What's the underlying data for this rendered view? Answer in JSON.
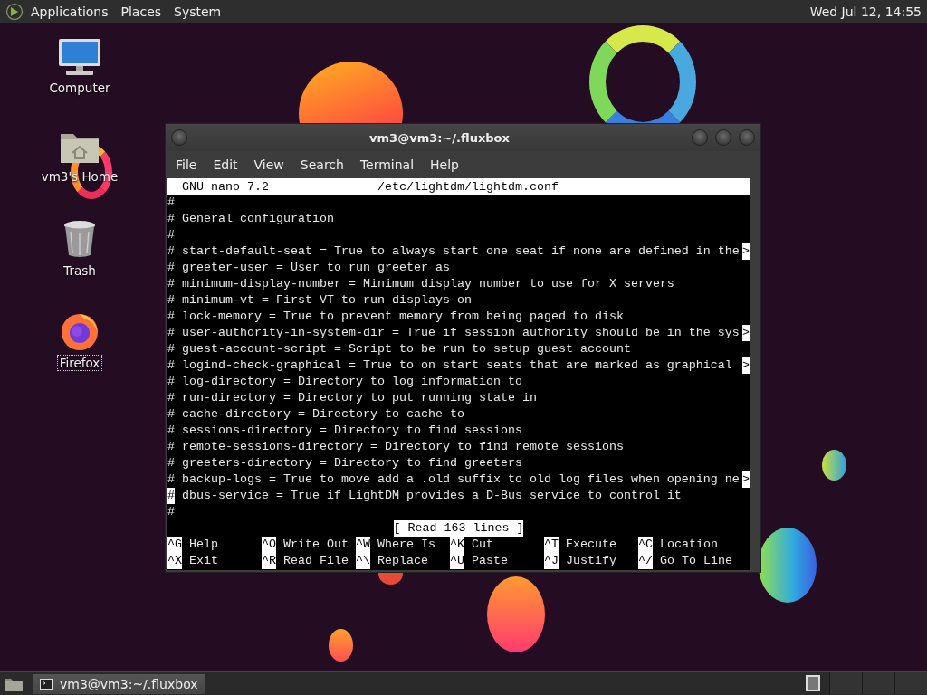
{
  "top_panel": {
    "menus": [
      {
        "label": "Applications"
      },
      {
        "label": "Places"
      },
      {
        "label": "System"
      }
    ],
    "clock": "Wed Jul 12, 14:55"
  },
  "desktop_icons": [
    {
      "label": "Computer",
      "kind": "computer",
      "selected": false
    },
    {
      "label": "vm3's Home",
      "kind": "home",
      "selected": false
    },
    {
      "label": "Trash",
      "kind": "trash",
      "selected": false
    },
    {
      "label": "Firefox",
      "kind": "firefox",
      "selected": true
    }
  ],
  "window": {
    "title": "vm3@vm3:~/.fluxbox",
    "menu": [
      "File",
      "Edit",
      "View",
      "Search",
      "Terminal",
      "Help"
    ],
    "nano": {
      "version": "GNU nano 7.2",
      "file": "/etc/lightdm/lightdm.conf",
      "lines": [
        {
          "text": "#",
          "cursor": false
        },
        {
          "text": "# General configuration",
          "cursor": false
        },
        {
          "text": "#",
          "cursor": false
        },
        {
          "text": "# start-default-seat = True to always start one seat if none are defined in the",
          "overflow_mark": ">",
          "cursor": false
        },
        {
          "text": "# greeter-user = User to run greeter as",
          "cursor": false
        },
        {
          "text": "# minimum-display-number = Minimum display number to use for X servers",
          "cursor": false
        },
        {
          "text": "# minimum-vt = First VT to run displays on",
          "cursor": false
        },
        {
          "text": "# lock-memory = True to prevent memory from being paged to disk",
          "cursor": false
        },
        {
          "text": "# user-authority-in-system-dir = True if session authority should be in the sys",
          "overflow_mark": ">",
          "cursor": false
        },
        {
          "text": "# guest-account-script = Script to be run to setup guest account",
          "cursor": false
        },
        {
          "text": "# logind-check-graphical = True to on start seats that are marked as graphical ",
          "overflow_mark": ">",
          "cursor": false
        },
        {
          "text": "# log-directory = Directory to log information to",
          "cursor": false
        },
        {
          "text": "# run-directory = Directory to put running state in",
          "cursor": false
        },
        {
          "text": "# cache-directory = Directory to cache to",
          "cursor": false
        },
        {
          "text": "# sessions-directory = Directory to find sessions",
          "cursor": false
        },
        {
          "text": "# remote-sessions-directory = Directory to find remote sessions",
          "cursor": false
        },
        {
          "text": "# greeters-directory = Directory to find greeters",
          "cursor": false
        },
        {
          "text": "# backup-logs = True to move add a .old suffix to old log files when opening ne",
          "overflow_mark": ">",
          "cursor": false
        },
        {
          "text": "# dbus-service = True if LightDM provides a D-Bus service to control it",
          "cursor": true
        },
        {
          "text": "#",
          "cursor": false
        }
      ],
      "status": "[ Read 163 lines ]",
      "shortcuts": [
        [
          {
            "key": "^G",
            "label": "Help"
          },
          {
            "key": "^O",
            "label": "Write Out"
          },
          {
            "key": "^W",
            "label": "Where Is"
          },
          {
            "key": "^K",
            "label": "Cut"
          },
          {
            "key": "^T",
            "label": "Execute"
          },
          {
            "key": "^C",
            "label": "Location"
          }
        ],
        [
          {
            "key": "^X",
            "label": "Exit"
          },
          {
            "key": "^R",
            "label": "Read File"
          },
          {
            "key": "^\\",
            "label": "Replace"
          },
          {
            "key": "^U",
            "label": "Paste"
          },
          {
            "key": "^J",
            "label": "Justify"
          },
          {
            "key": "^/",
            "label": "Go To Line"
          }
        ]
      ]
    }
  },
  "taskbar": {
    "tasks": [
      {
        "label": "vm3@vm3:~/.fluxbox",
        "selected": true
      }
    ],
    "workspaces": [
      {
        "selected": true
      },
      {
        "selected": false
      },
      {
        "selected": false
      },
      {
        "selected": false
      }
    ]
  }
}
